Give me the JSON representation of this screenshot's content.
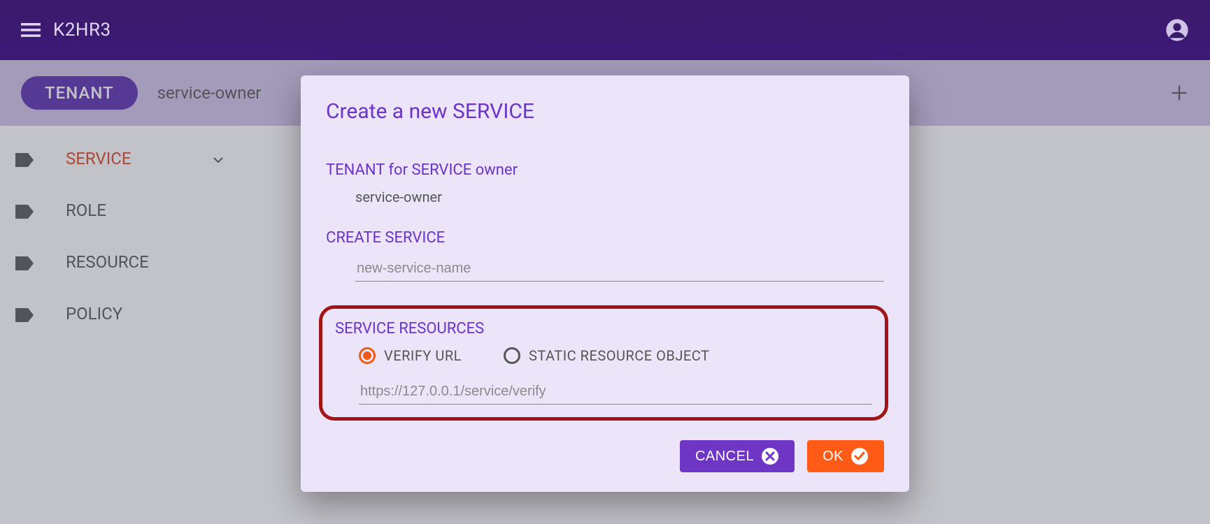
{
  "header": {
    "title": "K2HR3"
  },
  "tenant_bar": {
    "pill": "TENANT",
    "name": "service-owner"
  },
  "sidebar": {
    "items": [
      {
        "label": "SERVICE",
        "active": true,
        "expandable": true
      },
      {
        "label": "ROLE"
      },
      {
        "label": "RESOURCE"
      },
      {
        "label": "POLICY"
      }
    ]
  },
  "modal": {
    "title": "Create a new SERVICE",
    "tenant_label": "TENANT for SERVICE owner",
    "tenant_value": "service-owner",
    "create_label": "CREATE SERVICE",
    "create_placeholder": "new-service-name",
    "resources_label": "SERVICE RESOURCES",
    "radio": {
      "verify": "VERIFY URL",
      "static": "STATIC RESOURCE OBJECT"
    },
    "verify_placeholder": "https://127.0.0.1/service/verify",
    "buttons": {
      "cancel": "CANCEL",
      "ok": "OK"
    }
  }
}
